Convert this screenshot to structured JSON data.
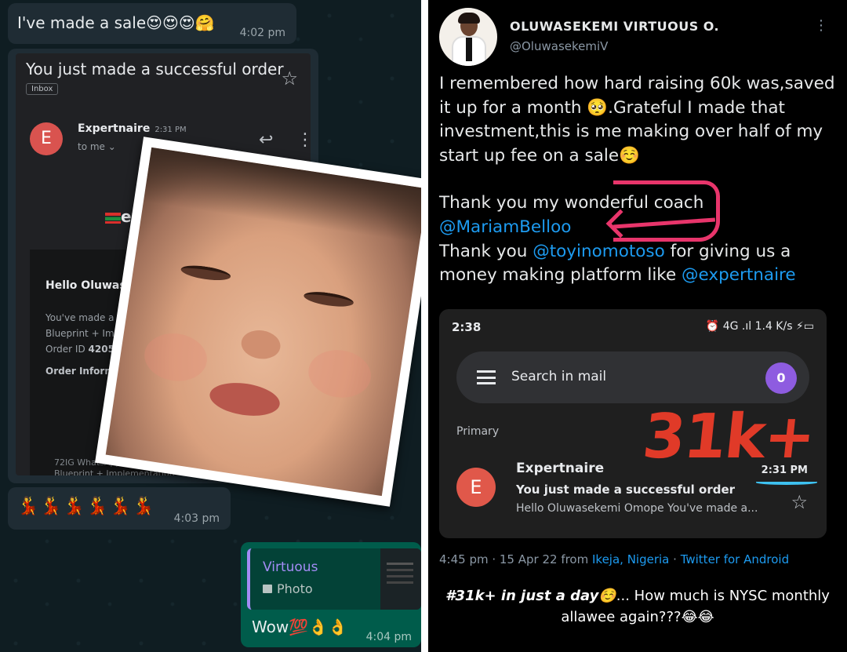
{
  "whatsapp": {
    "msg1": {
      "text": "I've made a sale😍😍😍🤗",
      "time": "4:02 pm"
    },
    "gmail_screenshot": {
      "subject": "You just made a successful order",
      "inbox_label": "Inbox",
      "avatar_letter": "E",
      "sender": "Expertnaire",
      "sender_time": "2:31 PM",
      "to": "to me ⌄",
      "logo_text": "exp",
      "hello": "Hello Oluwase",
      "line1": "You've made a",
      "line2": "Blueprint + Imp",
      "line3_prefix": "Order ID ",
      "line3_value": "4205",
      "order_info": "Order Inform",
      "footer1": "72IG WhatsApp",
      "footer2": "Blueprint + Implementation"
    },
    "emoji_msg": {
      "text": "💃💃💃💃💃💃",
      "time": "4:03 pm"
    },
    "reply_msg": {
      "quote_name": "Virtuous",
      "quote_type": "Photo",
      "text": "Wow💯👌👌",
      "time": "4:04 pm"
    }
  },
  "tweet": {
    "display_name": "OLUWASEKEMI VIRTUOUS O.",
    "handle": "@OluwasekemiV",
    "para1": "I remembered how hard raising 60k was,saved it up for a month 🥺.Grateful I made that investment,this is me making over half of my start up fee on a sale☺️",
    "thanks1": "Thank you my wonderful coach",
    "mention1": "@MariamBelloo",
    "thanks2_prefix": "Thank you ",
    "mention2": "@toyinomotoso",
    "thanks2_suffix": " for giving us a",
    "thanks3_prefix": "money making platform like ",
    "mention3": "@expertnaire",
    "meta_prefix": "4:45 pm · 15 Apr 22 from ",
    "meta_location": "Ikeja, Nigeria",
    "meta_sep": " · ",
    "meta_client": "Twitter for Android",
    "caption_bold": "#31k+ in just a day☺️",
    "caption_rest": "... How much is NYSC monthly allawee again???😂😂"
  },
  "gmail_embed": {
    "status_time": "2:38",
    "status_icons": "⏰ 4G .ıl 1.4 K/s ⚡▭",
    "search_placeholder": "Search in mail",
    "account_badge": "0",
    "section_label": "Primary",
    "annotation": "31k+",
    "avatar_letter": "E",
    "sender": "Expertnaire",
    "subject": "You just made a successful order",
    "snippet": "Hello Oluwasekemi Omope You've made a...",
    "time": "2:31 PM"
  }
}
